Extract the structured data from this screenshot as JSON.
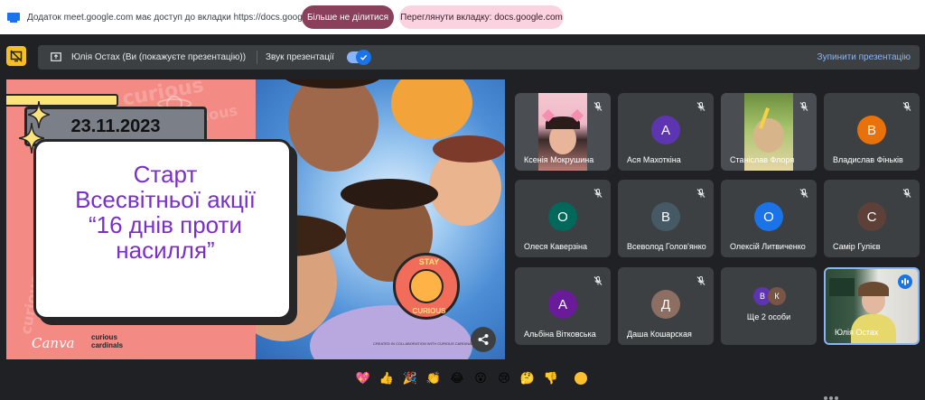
{
  "share_bar": {
    "message": "Додаток meet.google.com має доступ до вкладки https://docs.google.com",
    "stop_label": "Більше не ділитися",
    "view_label": "Переглянути вкладку: docs.google.com"
  },
  "present_bar": {
    "presenter": "Юлія Остах (Ви (покажуєте презентацію))",
    "sound_label": "Звук презентації",
    "sound_on": true,
    "stop_label": "Зупинити презентацію"
  },
  "slide": {
    "date": "23.11.2023",
    "title_lines": [
      "Старт",
      "Всесвітньої акції",
      "“16 днів проти",
      "насилля”"
    ],
    "deco_text": "curious",
    "brand": "Canva",
    "logo_lines": [
      "curious",
      "cardinals"
    ],
    "badge_top": "STAY",
    "badge_bottom": "CURIOUS",
    "credit": "CREATED IN COLLABORATION WITH CURIOUS CARDINALS"
  },
  "participants": [
    {
      "name": "Ксенія Мокрушина",
      "type": "video",
      "muted": true,
      "video": "girl-pink"
    },
    {
      "name": "Ася Махоткіна",
      "type": "avatar",
      "initial": "А",
      "color": "#5e35b1",
      "muted": true
    },
    {
      "name": "Станіслав Флоря",
      "type": "video",
      "muted": true,
      "video": "boy-green"
    },
    {
      "name": "Владислав Фіньків",
      "type": "avatar",
      "initial": "В",
      "color": "#e8710a",
      "muted": true
    },
    {
      "name": "Олеся Каверзіна",
      "type": "avatar",
      "initial": "О",
      "color": "#00695c",
      "muted": true
    },
    {
      "name": "Всеволод Голов'янко",
      "type": "avatar",
      "initial": "В",
      "color": "#455a64",
      "muted": true
    },
    {
      "name": "Олексій Литвиченко",
      "type": "avatar",
      "initial": "О",
      "color": "#1a73e8",
      "muted": true
    },
    {
      "name": "Самір Гулієв",
      "type": "avatar",
      "initial": "С",
      "color": "#5d4037",
      "muted": true
    },
    {
      "name": "Альбіна Вітковська",
      "type": "avatar",
      "initial": "А",
      "color": "#6a1b9a",
      "muted": true
    },
    {
      "name": "Даша Кошарская",
      "type": "avatar",
      "initial": "Д",
      "color": "#8d6e63",
      "muted": true
    },
    {
      "name": "Ще 2 особи",
      "type": "more",
      "initials": [
        "В",
        "К"
      ],
      "colors": [
        "#5e35b1",
        "#795548"
      ]
    },
    {
      "name": "Юлія Остах",
      "type": "self",
      "speaking": true,
      "video": "woman-classroom"
    }
  ],
  "reactions": [
    "💖",
    "👍",
    "🎉",
    "👏",
    "😂",
    "😮",
    "😢",
    "🤔",
    "👎"
  ]
}
